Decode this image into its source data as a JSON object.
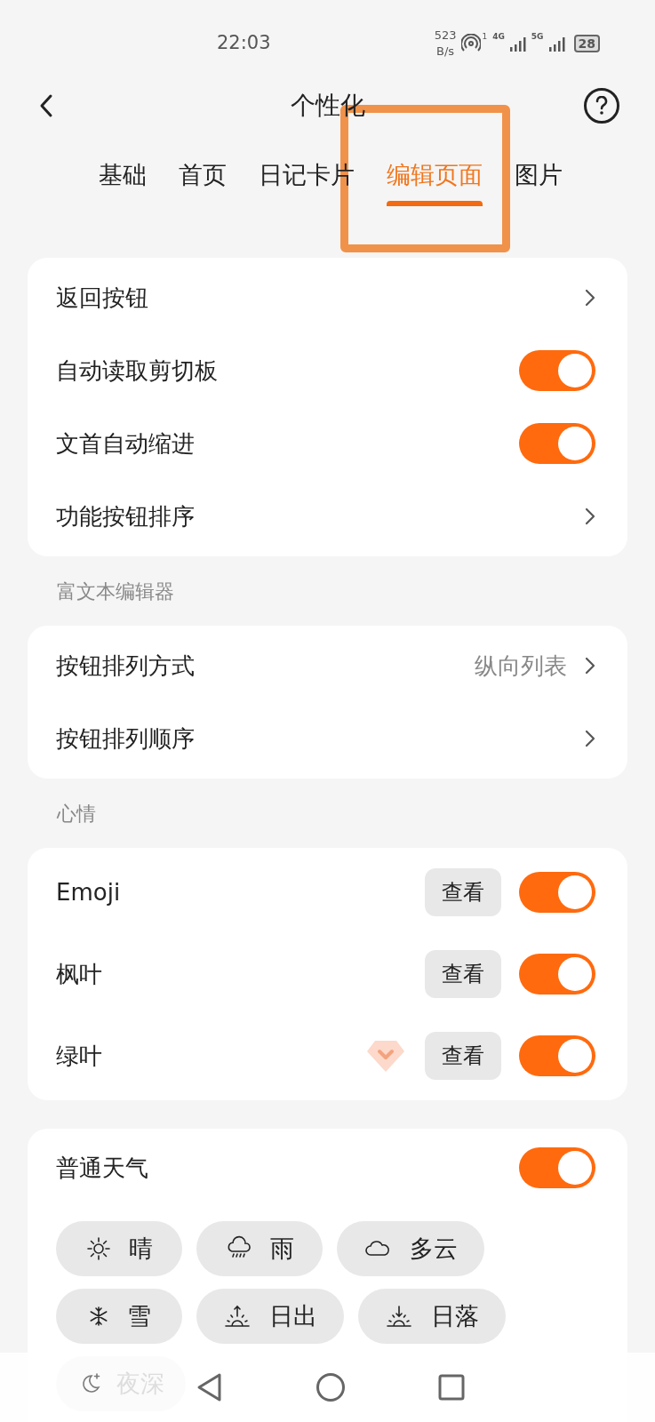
{
  "status_bar": {
    "time": "22:03",
    "speed": "523",
    "speed_unit": "B/s",
    "hotspot_sup": "1",
    "net1": "4G",
    "net2": "5G",
    "battery": "28"
  },
  "header": {
    "title": "个性化"
  },
  "tabs": [
    {
      "label": "基础",
      "selected": false
    },
    {
      "label": "首页",
      "selected": false
    },
    {
      "label": "日记卡片",
      "selected": false
    },
    {
      "label": "编辑页面",
      "selected": true
    },
    {
      "label": "图片",
      "selected": false
    }
  ],
  "sections": [
    {
      "rows": [
        {
          "kind": "link",
          "label": "返回按钮"
        },
        {
          "kind": "toggle",
          "label": "自动读取剪切板",
          "on": true
        },
        {
          "kind": "toggle",
          "label": "文首自动缩进",
          "on": true
        },
        {
          "kind": "link",
          "label": "功能按钮排序"
        }
      ]
    },
    {
      "label": "富文本编辑器",
      "rows": [
        {
          "kind": "link",
          "label": "按钮排列方式",
          "value": "纵向列表"
        },
        {
          "kind": "link",
          "label": "按钮排列顺序"
        }
      ]
    },
    {
      "label": "心情",
      "rows": [
        {
          "kind": "mood",
          "label": "Emoji",
          "button": "查看",
          "on": true,
          "premium": false
        },
        {
          "kind": "mood",
          "label": "枫叶",
          "button": "查看",
          "on": true,
          "premium": false
        },
        {
          "kind": "mood",
          "label": "绿叶",
          "button": "查看",
          "on": true,
          "premium": true
        }
      ]
    }
  ],
  "weather": {
    "label": "普通天气",
    "on": true,
    "chips": [
      {
        "kind": "sun",
        "label": "晴"
      },
      {
        "kind": "rain",
        "label": "雨"
      },
      {
        "kind": "cloud",
        "label": "多云"
      },
      {
        "kind": "snow",
        "label": "雪"
      },
      {
        "kind": "sunrise",
        "label": "日出"
      },
      {
        "kind": "sunset",
        "label": "日落"
      },
      {
        "kind": "moon",
        "label": "夜深"
      }
    ]
  }
}
